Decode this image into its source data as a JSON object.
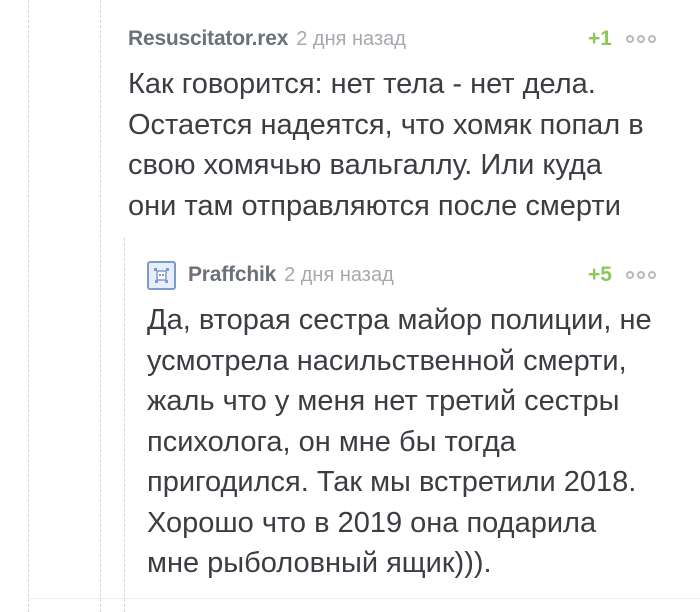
{
  "comments": [
    {
      "author": "Resuscitator.rex",
      "time": "2 дня назад",
      "score": "+1",
      "text": "Как говорится: нет тела - нет дела. Остается надеятся, что хомяк попал в свою хомячью вальгаллу. Или куда они там отправляются после смерти"
    },
    {
      "author": "Praffchik",
      "time": "2 дня назад",
      "score": "+5",
      "avatar_icon": "avatar-icon",
      "text": "Да, вторая сестра майор полиции, не усмотрела насильственной смерти, жаль что у меня нет третий сестры психолога, он мне бы тогда пригодился. Так мы встретили 2018. Хорошо что в 2019 она подарила мне рыболовный ящик)))."
    }
  ],
  "colors": {
    "author": "#6b7178",
    "time": "#a5a9ae",
    "score": "#8ac858",
    "text": "#3a3d42",
    "thread_line": "#d4d4d4"
  },
  "icons": {
    "menu": "more-dots-icon"
  }
}
